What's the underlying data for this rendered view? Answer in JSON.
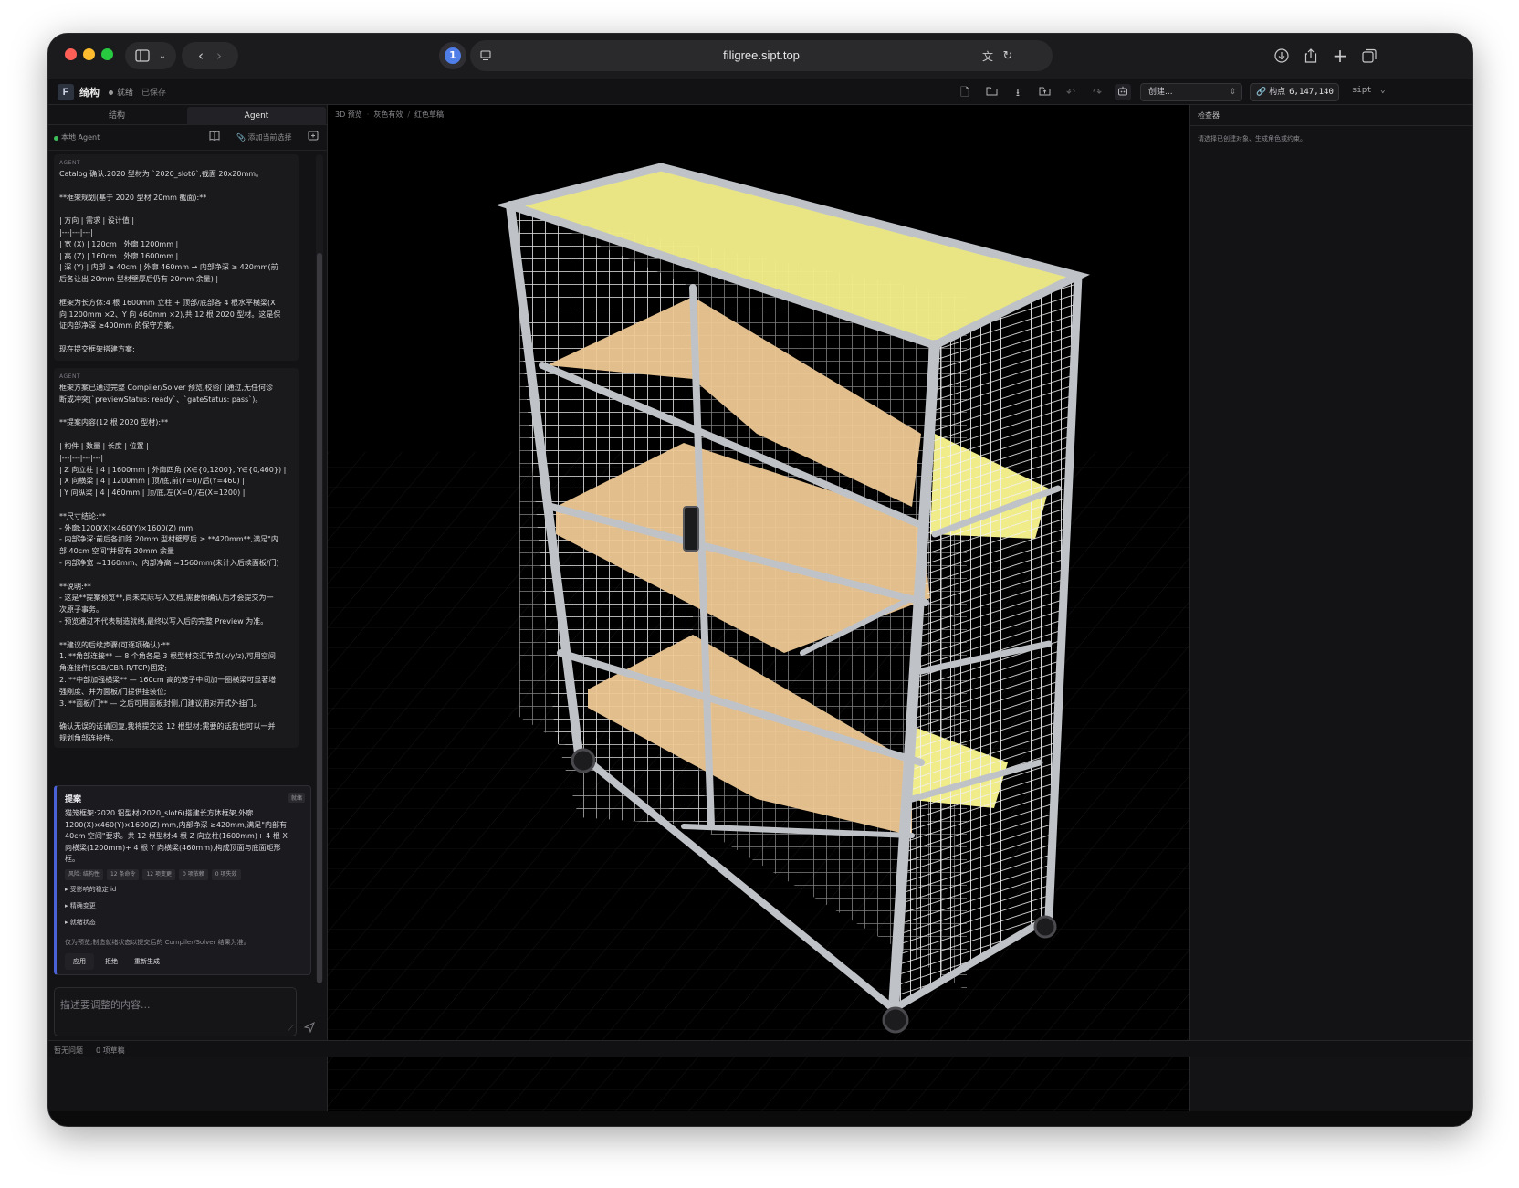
{
  "browser": {
    "url": "filigree.sipt.top",
    "onepassword_glyph": "1"
  },
  "app": {
    "logo": "F",
    "name": "绮构",
    "status": "就绪",
    "saved": "已保存",
    "create_select": "创建...",
    "count_label": "构点",
    "count_value": "6,147,140",
    "unit": "sipt"
  },
  "left_panel": {
    "tabs": [
      "结构",
      "Agent"
    ],
    "agent_label": "本地 Agent",
    "attach_label": "添加当前选择",
    "messages": [
      {
        "role": "AGENT",
        "lines": [
          "Catalog 确认:2020 型材为 `2020_slot6`,截面 20x20mm。",
          "",
          "**框架规划(基于 2020 型材 20mm 截面):**",
          "",
          "| 方向 | 需求 | 设计值 |",
          "|---|---|---|",
          "| 宽 (X) | 120cm | 外廓 1200mm |",
          "| 高 (Z) | 160cm | 外廓 1600mm |",
          "| 深 (Y) | 内部 ≥ 40cm | 外廓 460mm → 内部净深 ≥ 420mm(前",
          "后各让出 20mm 型材壁厚后仍有 20mm 余量) |",
          "",
          "框架为长方体:4 根 1600mm 立柱 + 顶部/底部各 4 根水平横梁(X",
          "向 1200mm ×2、Y 向 460mm ×2),共 12 根 2020 型材。这是保",
          "证内部净深 ≥400mm 的保守方案。",
          "",
          "现在提交框架搭建方案:"
        ]
      },
      {
        "role": "AGENT",
        "lines": [
          "框架方案已通过完整 Compiler/Solver 预览,校验门通过,无任何诊",
          "断或冲突(`previewStatus: ready`、`gateStatus: pass`)。",
          "",
          "**提案内容(12 根 2020 型材):**",
          "",
          "| 构件 | 数量 | 长度 | 位置 |",
          "|---|---|---|---|",
          "| Z 向立柱 | 4 | 1600mm | 外廓四角 (X∈{0,1200}, Y∈{0,460}) |",
          "| X 向横梁 | 4 | 1200mm | 顶/底,前(Y=0)/后(Y=460) |",
          "| Y 向纵梁 | 4 | 460mm | 顶/底,左(X=0)/右(X=1200) |",
          "",
          "**尺寸结论:**",
          "- 外廓:1200(X)×460(Y)×1600(Z) mm",
          "- 内部净深:前后各扣除 20mm 型材壁厚后 ≥ **420mm**,满足\"内",
          "部 40cm 空间\"并留有 20mm 余量",
          "- 内部净宽 ≈1160mm、内部净高 ≈1560mm(未计入后续面板/门)",
          "",
          "**说明:**",
          "- 这是**提案预览**,尚未实际写入文档,需要你确认后才会提交为一",
          "次原子事务。",
          "- 预览通过不代表制造就绪,最终以写入后的完整 Preview 为准。",
          "",
          "**建议的后续步骤(可逐项确认):**",
          "1. **角部连接** — 8 个角各是 3 根型材交汇节点(x/y/z),可用空间",
          "角连接件(SCB/CBR-R/TCP)固定;",
          "2. **中部加强横梁** — 160cm 高的笼子中间加一圈横梁可显著增",
          "强刚度、并为面板/门提供挂装位;",
          "3. **面板/门** — 之后可用面板封侧,门建议用对开式外挂门。",
          "",
          "确认无误的话请回复,我将提交这 12 根型材;需要的话我也可以一并",
          "规划角部连接件。"
        ]
      }
    ],
    "proposal": {
      "title": "提案",
      "status": "就绪",
      "lines": [
        "猫笼框架:2020 铝型材(2020_slot6)搭建长方体框架,外廓",
        "1200(X)×460(Y)×1600(Z) mm,内部净深 ≥420mm,满足\"内部有",
        "40cm 空间\"要求。共 12 根型材:4 根 Z 向立柱(1600mm)+ 4 根 X",
        "向横梁(1200mm)+ 4 根 Y 向横梁(460mm),构成顶面与底面矩形",
        "框。"
      ],
      "chips": [
        "风险: 结构性",
        "12 条命令",
        "12 项变更",
        "0 项依赖",
        "0 项失效"
      ],
      "disclosures": [
        "受影响的稳定 id",
        "精确变更",
        "就绪状态"
      ],
      "note": "仅为预览;制造就绪状态以提交后的 Compiler/Solver 结果为准。",
      "actions": [
        "应用",
        "拒绝",
        "重新生成"
      ]
    },
    "input_placeholder": "描述要调整的内容..."
  },
  "viewport": {
    "breadcrumb": [
      "3D 预览",
      "灰色有效",
      "红色草稿"
    ]
  },
  "inspector": {
    "title": "检查器",
    "hint": "请选择已创建对象、生成角色或约束。"
  },
  "statusbar": {
    "issues": "暂无问题",
    "drafts": "0 项草稿"
  },
  "colors": {
    "accent": "#4b62d6",
    "ready_green": "#3fbf5a",
    "panel_top": "#f3ee8a",
    "shelf": "#eec894",
    "frame": "#bfc3c8"
  }
}
